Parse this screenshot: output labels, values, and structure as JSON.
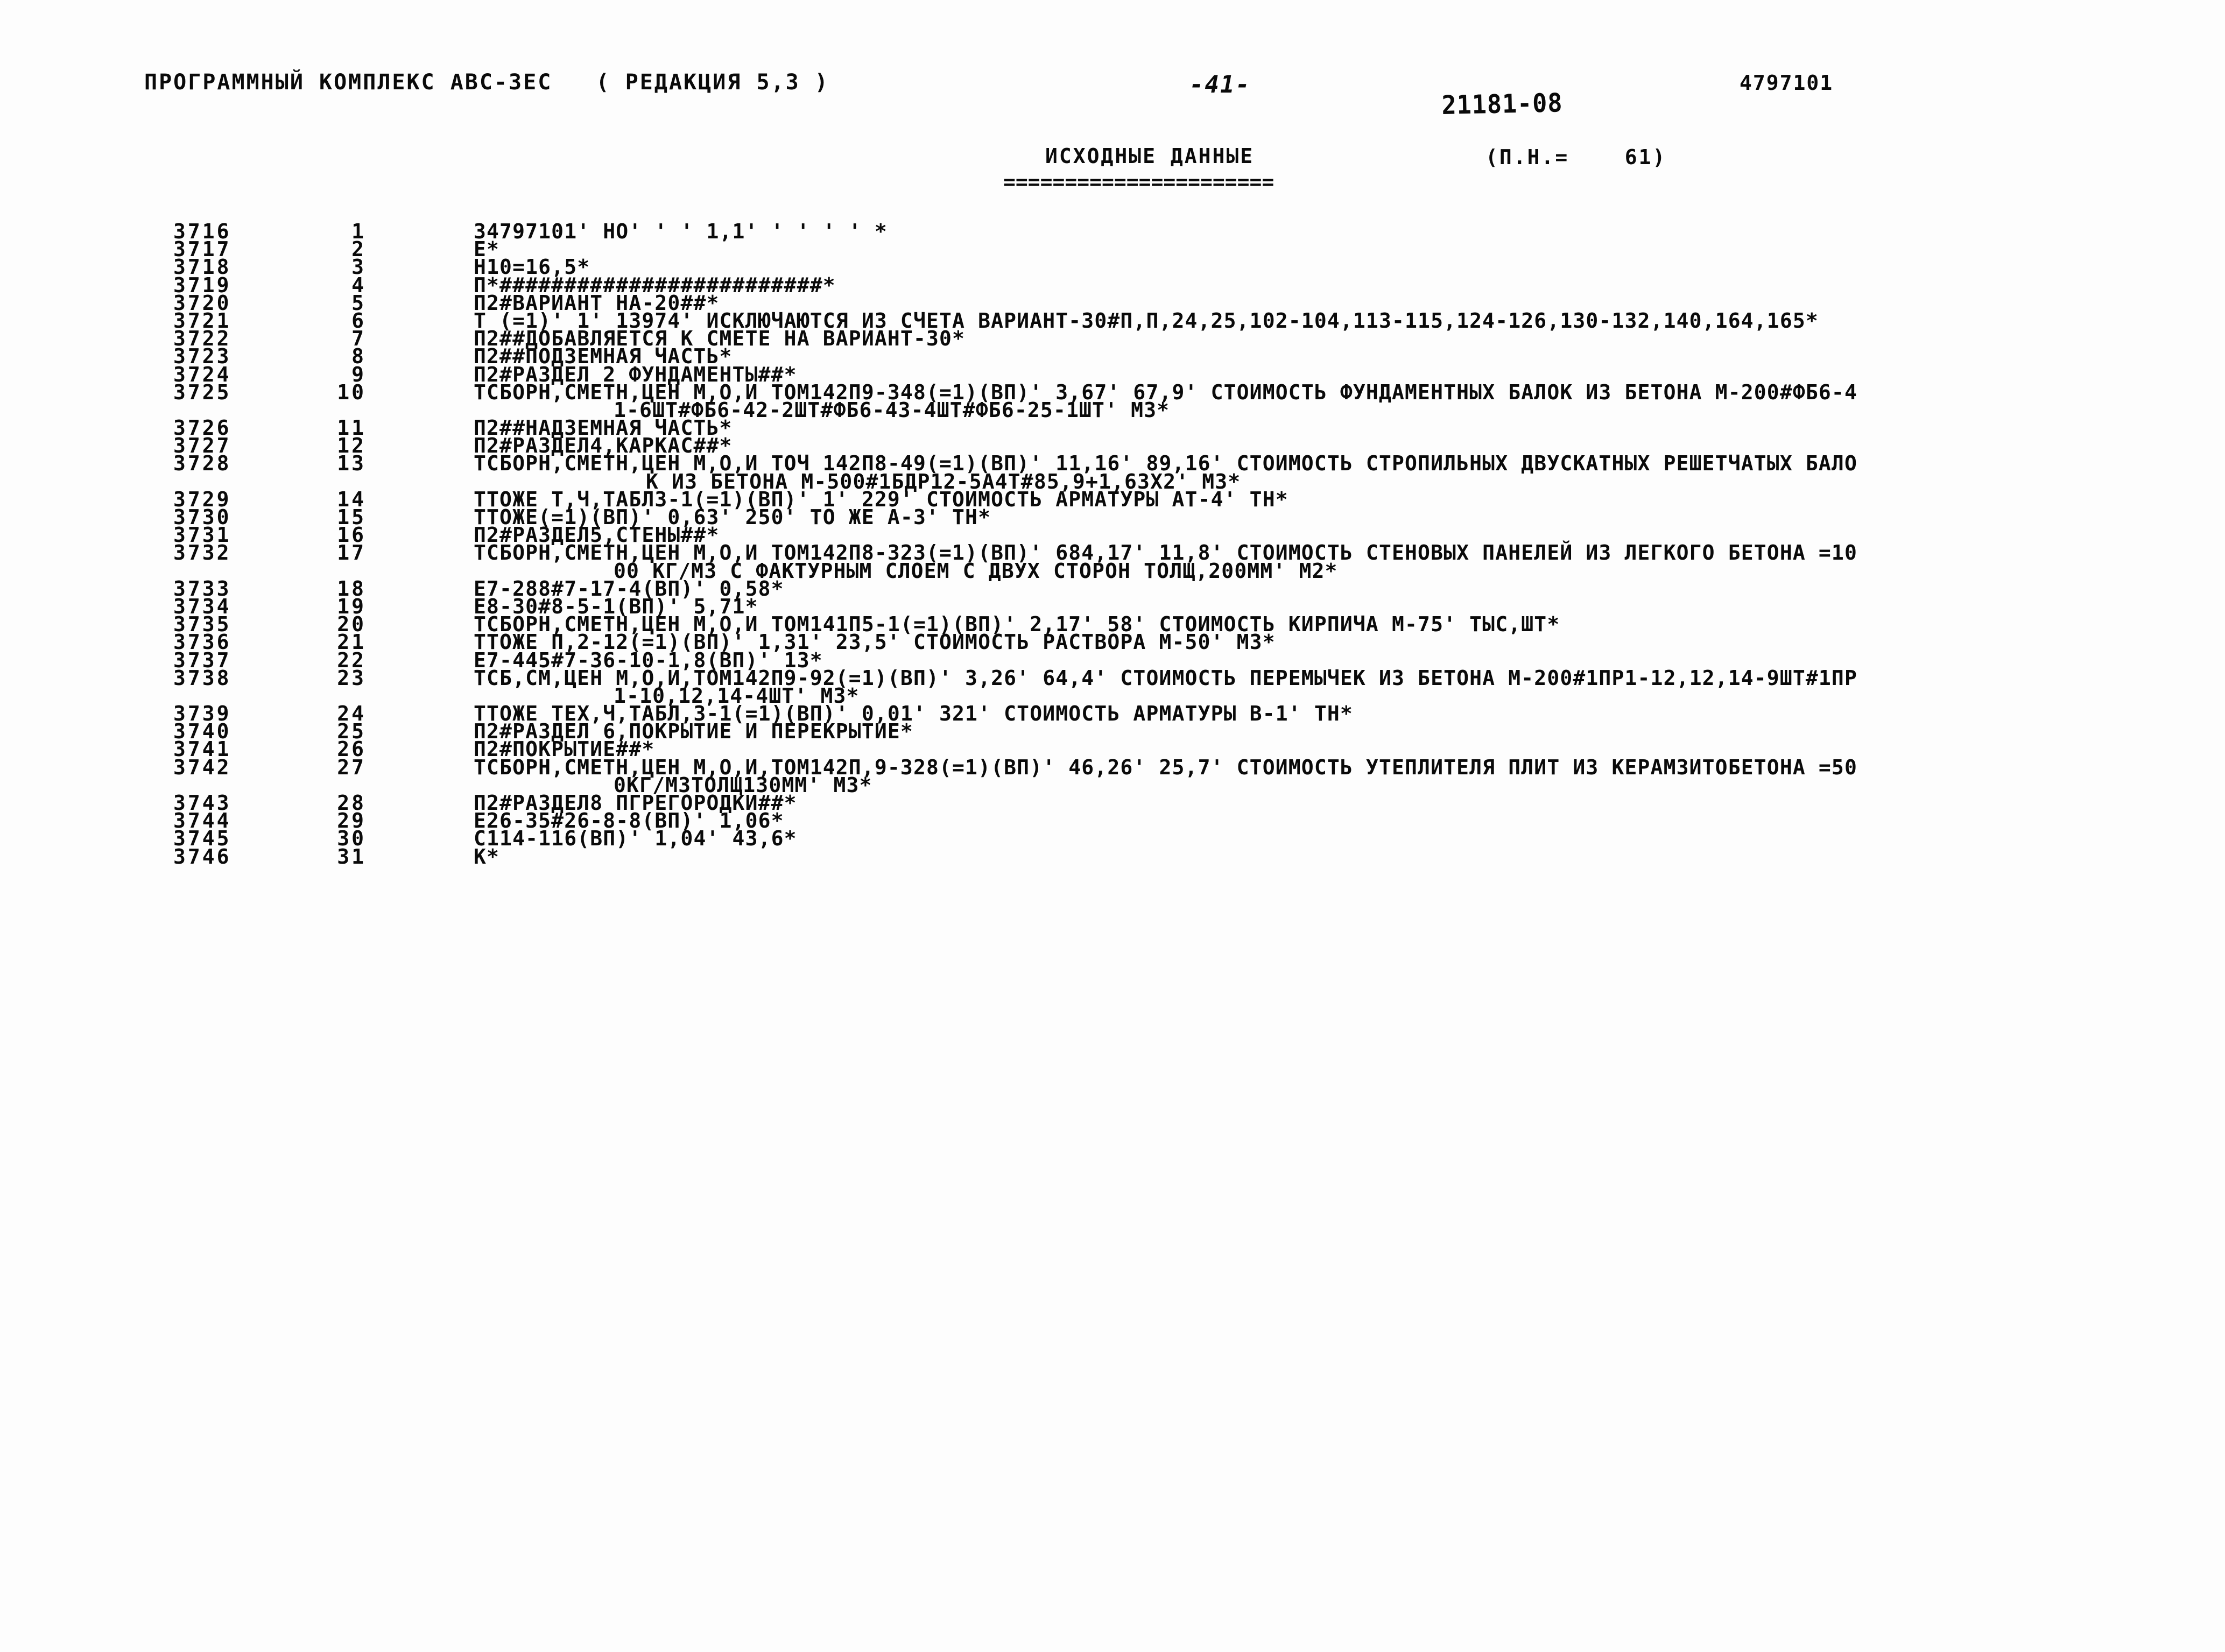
{
  "header": {
    "program_title": "ПРОГРАММНЫЙ КОМПЛЕКС АВС-3ЕС   ( РЕДАКЦИЯ 5,3 )",
    "page_number": "-41-",
    "stamp_number": "21181-08",
    "document_number": "4797101"
  },
  "subtitle": {
    "title": "ИСХОДНЫЕ ДАННЫЕ",
    "rule": "======================",
    "pn_label": "(П.Н.=    61)"
  },
  "listing": {
    "rows": [
      {
        "line": "3716",
        "seq": "1",
        "text": "34797101' НО' ' ' 1,1' ' ' ' ' *"
      },
      {
        "line": "3717",
        "seq": "2",
        "text": "Е*"
      },
      {
        "line": "3718",
        "seq": "3",
        "text": "Н10=16,5*"
      },
      {
        "line": "3719",
        "seq": "4",
        "text": "П*#########################*"
      },
      {
        "line": "3720",
        "seq": "5",
        "text": "П2#ВАРИАНТ НА-20##*"
      },
      {
        "line": "3721",
        "seq": "6",
        "text": "Т (=1)' 1' 13974' ИСКЛЮЧАЮТСЯ ИЗ СЧЕТА ВАРИАНТ-30#П,П,24,25,102-104,113-115,124-126,130-132,140,164,165*"
      },
      {
        "line": "3722",
        "seq": "7",
        "text": "П2##ДОБАВЛЯЕТСЯ К СМЕТЕ НА ВАРИАНТ-30*"
      },
      {
        "line": "3723",
        "seq": "8",
        "text": "П2##ПОДЗЕМНАЯ ЧАСТЬ*"
      },
      {
        "line": "3724",
        "seq": "9",
        "text": "П2#РАЗДЕЛ 2 ФУНДАМЕНТЫ##*"
      },
      {
        "line": "3725",
        "seq": "10",
        "text": "ТСБОРН,СМЕТН,ЦЕН М,О,И ТОМ142П9-348(=1)(ВП)' 3,67' 67,9' СТОИМОСТЬ ФУНДАМЕНТНЫХ БАЛОК ИЗ БЕТОНА М-200#ФБ6-4"
      },
      {
        "line": "",
        "seq": "",
        "text": "1-6ШТ#ФБ6-42-2ШТ#ФБ6-43-4ШТ#ФБ6-25-1ШТ' М3*",
        "indent": 260
      },
      {
        "line": "3726",
        "seq": "11",
        "text": "П2##НАДЗЕМНАЯ ЧАСТЬ*"
      },
      {
        "line": "3727",
        "seq": "12",
        "text": "П2#РАЗДЕЛ4,КАРКАС##*"
      },
      {
        "line": "3728",
        "seq": "13",
        "text": "ТСБОРН,СМЕТН,ЦЕН М,О,И ТОЧ 142П8-49(=1)(ВП)' 11,16' 89,16' СТОИМОСТЬ СТРОПИЛЬНЫХ ДВУСКАТНЫХ РЕШЕТЧАТЫХ БАЛО"
      },
      {
        "line": "",
        "seq": "",
        "text": "К ИЗ БЕТОНА М-500#1БДР12-5А4Т#85,9+1,63Х2' М3*",
        "indent": 320
      },
      {
        "line": "3729",
        "seq": "14",
        "text": "ТТОЖЕ Т,Ч,ТАБЛ3-1(=1)(ВП)' 1' 229' СТОИМОСТЬ АРМАТУРЫ АТ-4' ТН*"
      },
      {
        "line": "3730",
        "seq": "15",
        "text": "ТТОЖЕ(=1)(ВП)' 0,63' 250' ТО ЖЕ А-3' ТН*"
      },
      {
        "line": "3731",
        "seq": "16",
        "text": "П2#РАЗДЕЛ5,СТЕНЫ##*"
      },
      {
        "line": "3732",
        "seq": "17",
        "text": "ТСБОРН,СМЕТН,ЦЕН М,О,И ТОМ142П8-323(=1)(ВП)' 684,17' 11,8' СТОИМОСТЬ СТЕНОВЫХ ПАНЕЛЕЙ ИЗ ЛЕГКОГО БЕТОНА =10"
      },
      {
        "line": "",
        "seq": "",
        "text": "00 КГ/М3 С ФАКТУРНЫМ СЛОЕМ С ДВУХ СТОРОН ТОЛЩ,200ММ' М2*",
        "indent": 260
      },
      {
        "line": "3733",
        "seq": "18",
        "text": "Е7-288#7-17-4(ВП)' 0,58*"
      },
      {
        "line": "3734",
        "seq": "19",
        "text": "Е8-30#8-5-1(ВП)' 5,71*"
      },
      {
        "line": "3735",
        "seq": "20",
        "text": "ТСБОРН,СМЕТН,ЦЕН М,О,И ТОМ141П5-1(=1)(ВП)' 2,17' 58' СТОИМОСТЬ КИРПИЧА М-75' ТЫС,ШТ*"
      },
      {
        "line": "3736",
        "seq": "21",
        "text": "ТТОЖЕ П,2-12(=1)(ВП)' 1,31' 23,5' СТОИМОСТЬ РАСТВОРА М-50' М3*"
      },
      {
        "line": "3737",
        "seq": "22",
        "text": "Е7-445#7-36-10-1,8(ВП)' 13*"
      },
      {
        "line": "3738",
        "seq": "23",
        "text": "ТСБ,СМ,ЦЕН М,О,И,ТОМ142П9-92(=1)(ВП)' 3,26' 64,4' СТОИМОСТЬ ПЕРЕМЫЧЕК ИЗ БЕТОНА М-200#1ПР1-12,12,14-9ШТ#1ПР"
      },
      {
        "line": "",
        "seq": "",
        "text": "1-10,12,14-4ШТ' М3*",
        "indent": 260
      },
      {
        "line": "3739",
        "seq": "24",
        "text": "ТТОЖЕ ТЕХ,Ч,ТАБЛ,3-1(=1)(ВП)' 0,01' 321' СТОИМОСТЬ АРМАТУРЫ В-1' ТН*"
      },
      {
        "line": "3740",
        "seq": "25",
        "text": "П2#РАЗДЕЛ 6,ПОКРЫТИЕ И ПЕРЕКРЫТИЕ*"
      },
      {
        "line": "3741",
        "seq": "26",
        "text": "П2#ПОКРЫТИЕ##*"
      },
      {
        "line": "3742",
        "seq": "27",
        "text": "ТСБОРН,СМЕТН,ЦЕН М,О,И,ТОМ142П,9-328(=1)(ВП)' 46,26' 25,7' СТОИМОСТЬ УТЕПЛИТЕЛЯ ПЛИТ ИЗ КЕРАМЗИТОБЕТОНА =50"
      },
      {
        "line": "",
        "seq": "",
        "text": "0КГ/М3ТОЛЩ130ММ' М3*",
        "indent": 260
      },
      {
        "line": "3743",
        "seq": "28",
        "text": "П2#РАЗДЕЛ8 ПГРЕГОРОДКИ##*"
      },
      {
        "line": "3744",
        "seq": "29",
        "text": "Е26-35#26-8-8(ВП)' 1,06*"
      },
      {
        "line": "3745",
        "seq": "30",
        "text": "С114-116(ВП)' 1,04' 43,6*"
      },
      {
        "line": "3746",
        "seq": "31",
        "text": "К*"
      }
    ]
  }
}
